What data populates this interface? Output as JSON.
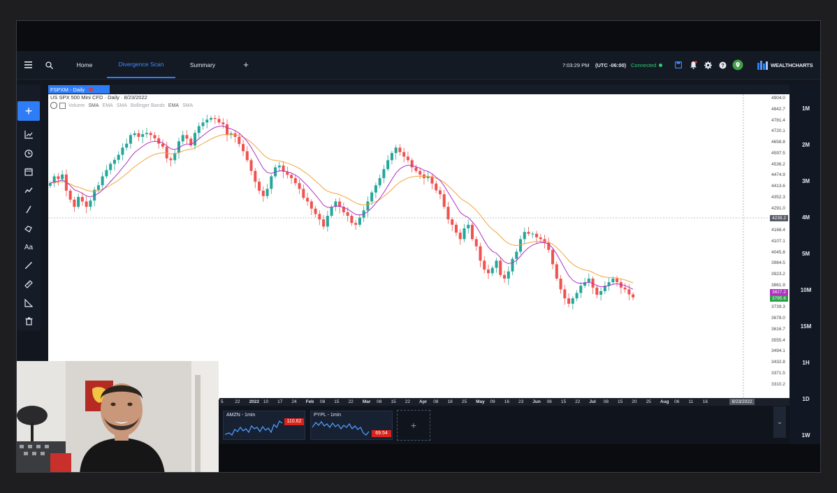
{
  "nav": {
    "tabs": [
      {
        "label": "Home"
      },
      {
        "label": "Divergence Scan"
      },
      {
        "label": "Summary"
      }
    ],
    "add_tab_label": "+",
    "time": "7:03:29 PM",
    "timezone": "(UTC -06:00)",
    "status": "Connected",
    "brand": "WEALTHCHARTS"
  },
  "symbol": {
    "badge": "FSPXM - Daily",
    "description": "US SPX 500 Mini CFD · Daily · 8/23/2022"
  },
  "indicators": [
    "Volume",
    "SMA",
    "EMA",
    "SMA",
    "Bollinger Bands",
    "EMA",
    "SMA"
  ],
  "price_axis": [
    "4904.0",
    "4842.7",
    "4781.4",
    "4720.1",
    "4658.8",
    "4597.5",
    "4536.2",
    "4474.9",
    "4413.6",
    "4352.3",
    "4291.0",
    "4229.7",
    "4168.4",
    "4107.1",
    "4045.8",
    "3984.5",
    "3923.2",
    "3861.9",
    "3800.6",
    "3739.3",
    "3678.0",
    "3616.7",
    "3555.4",
    "3494.1",
    "3432.8",
    "3371.5",
    "3310.2"
  ],
  "price_tags": {
    "crosshair": "4239.2",
    "ema_value": "3827.2",
    "last_price": "3795.6",
    "crosshair_date": "8/23/2022"
  },
  "date_axis": [
    "5",
    "22",
    "2022",
    "10",
    "17",
    "24",
    "Feb",
    "08",
    "15",
    "22",
    "Mar",
    "08",
    "15",
    "22",
    "Apr",
    "08",
    "18",
    "25",
    "May",
    "09",
    "16",
    "23",
    "Jun",
    "08",
    "15",
    "22",
    "Jul",
    "08",
    "15",
    "20",
    "25",
    "Aug",
    "06",
    "11",
    "16"
  ],
  "timeframes": [
    "1M",
    "2M",
    "3M",
    "4M",
    "5M",
    "10M",
    "15M",
    "1H",
    "1D",
    "1W"
  ],
  "watchlist": [
    {
      "symbol": "AMZN - 1min",
      "price": "110.62",
      "color": "#d9241c"
    },
    {
      "symbol": "PYPL - 1min",
      "price": "69.54",
      "color": "#d9241c"
    }
  ],
  "colors": {
    "accent": "#2f7df6",
    "up_candle": "#26a69a",
    "down_candle": "#ef5350",
    "ema_fast": "#b02ec4",
    "ema_slow": "#f2a33a",
    "connected": "#2ecc71"
  },
  "chart_data": {
    "type": "candlestick",
    "ylim": [
      3310.2,
      4904.0
    ],
    "series": [
      {
        "name": "price_close",
        "values": [
          4432,
          4470,
          4455,
          4480,
          4390,
          4340,
          4300,
          4355,
          4330,
          4300,
          4335,
          4395,
          4420,
          4470,
          4505,
          4540,
          4562,
          4590,
          4630,
          4652,
          4700,
          4710,
          4690,
          4705,
          4712,
          4700,
          4682,
          4652,
          4635,
          4570,
          4560,
          4600,
          4665,
          4700,
          4680,
          4642,
          4712,
          4750,
          4770,
          4786,
          4795,
          4790,
          4770,
          4760,
          4700,
          4710,
          4690,
          4650,
          4610,
          4560,
          4500,
          4440,
          4390,
          4360,
          4400,
          4470,
          4520,
          4530,
          4496,
          4478,
          4460,
          4432,
          4400,
          4350,
          4330,
          4290,
          4260,
          4230,
          4190,
          4250,
          4300,
          4330,
          4300,
          4270,
          4250,
          4210,
          4200,
          4240,
          4280,
          4330,
          4380,
          4420,
          4460,
          4510,
          4560,
          4600,
          4630,
          4605,
          4580,
          4560,
          4520,
          4500,
          4480,
          4460,
          4470,
          4430,
          4392,
          4370,
          4300,
          4230,
          4200,
          4156,
          4120,
          4180,
          4200,
          4120,
          4080,
          4000,
          3950,
          3930,
          3960,
          4000,
          3920,
          3900,
          3940,
          4010,
          4050,
          4120,
          4160,
          4150,
          4150,
          4130,
          4120,
          4100,
          4060,
          3980,
          3900,
          3840,
          3790,
          3760,
          3790,
          3820,
          3860,
          3880,
          3900,
          3850,
          3810,
          3830,
          3860,
          3880,
          3900,
          3880,
          3850,
          3840,
          3812,
          3795
        ]
      },
      {
        "name": "ema_fast",
        "values": []
      },
      {
        "name": "ema_slow",
        "values": []
      }
    ]
  }
}
